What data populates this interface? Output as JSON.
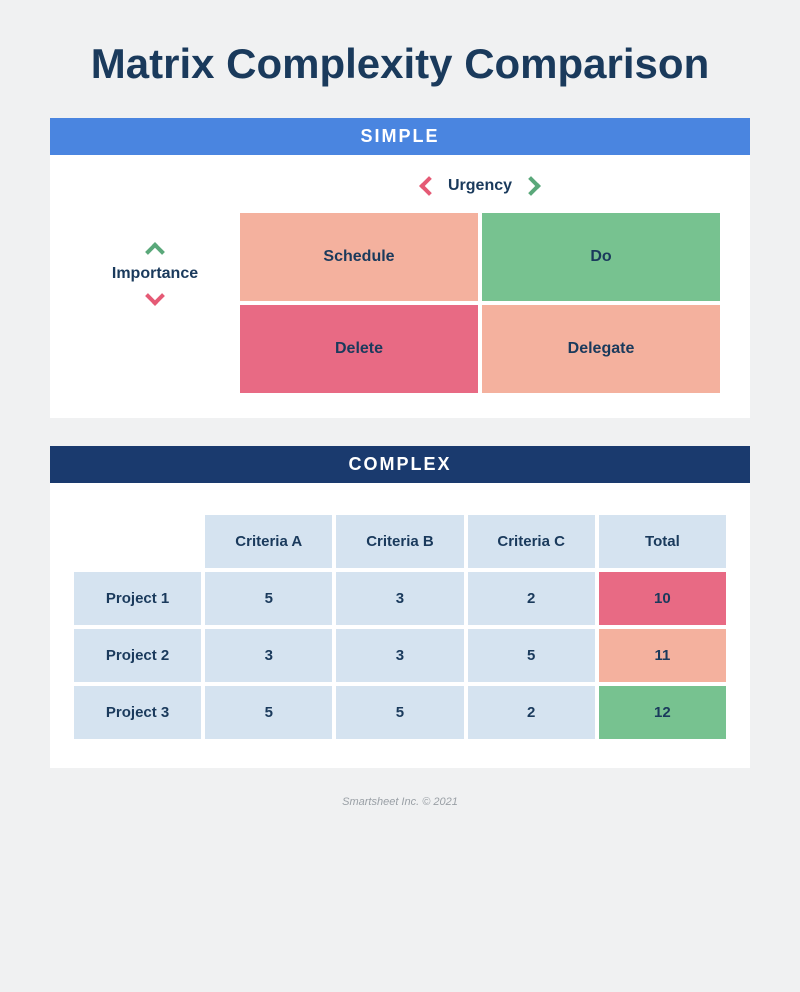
{
  "title": "Matrix Complexity Comparison",
  "simple": {
    "header": "SIMPLE",
    "xAxisLabel": "Urgency",
    "yAxisLabel": "Importance",
    "quadrants": {
      "topLeft": "Schedule",
      "topRight": "Do",
      "bottomLeft": "Delete",
      "bottomRight": "Delegate"
    }
  },
  "complex": {
    "header": "COMPLEX",
    "columns": [
      "Criteria A",
      "Criteria B",
      "Criteria C",
      "Total"
    ],
    "rows": [
      {
        "label": "Project 1",
        "values": [
          "5",
          "3",
          "2"
        ],
        "total": "10",
        "totalColor": "pink"
      },
      {
        "label": "Project 2",
        "values": [
          "3",
          "3",
          "5"
        ],
        "total": "11",
        "totalColor": "peach"
      },
      {
        "label": "Project 3",
        "values": [
          "5",
          "5",
          "2"
        ],
        "total": "12",
        "totalColor": "green"
      }
    ]
  },
  "footer": "Smartsheet Inc. © 2021",
  "chart_data": {
    "type": "table",
    "title": "Matrix Complexity Comparison",
    "simple_matrix": {
      "x_axis": "Urgency",
      "y_axis": "Importance",
      "cells": [
        {
          "xHighUrgency": false,
          "yHighImportance": true,
          "label": "Schedule"
        },
        {
          "xHighUrgency": true,
          "yHighImportance": true,
          "label": "Do"
        },
        {
          "xHighUrgency": false,
          "yHighImportance": false,
          "label": "Delete"
        },
        {
          "xHighUrgency": true,
          "yHighImportance": false,
          "label": "Delegate"
        }
      ]
    },
    "complex_matrix": {
      "criteria": [
        "Criteria A",
        "Criteria B",
        "Criteria C"
      ],
      "projects": [
        {
          "name": "Project 1",
          "scores": [
            5,
            3,
            2
          ],
          "total": 10
        },
        {
          "name": "Project 2",
          "scores": [
            3,
            3,
            5
          ],
          "total": 11
        },
        {
          "name": "Project 3",
          "scores": [
            5,
            5,
            2
          ],
          "total": 12
        }
      ]
    }
  }
}
